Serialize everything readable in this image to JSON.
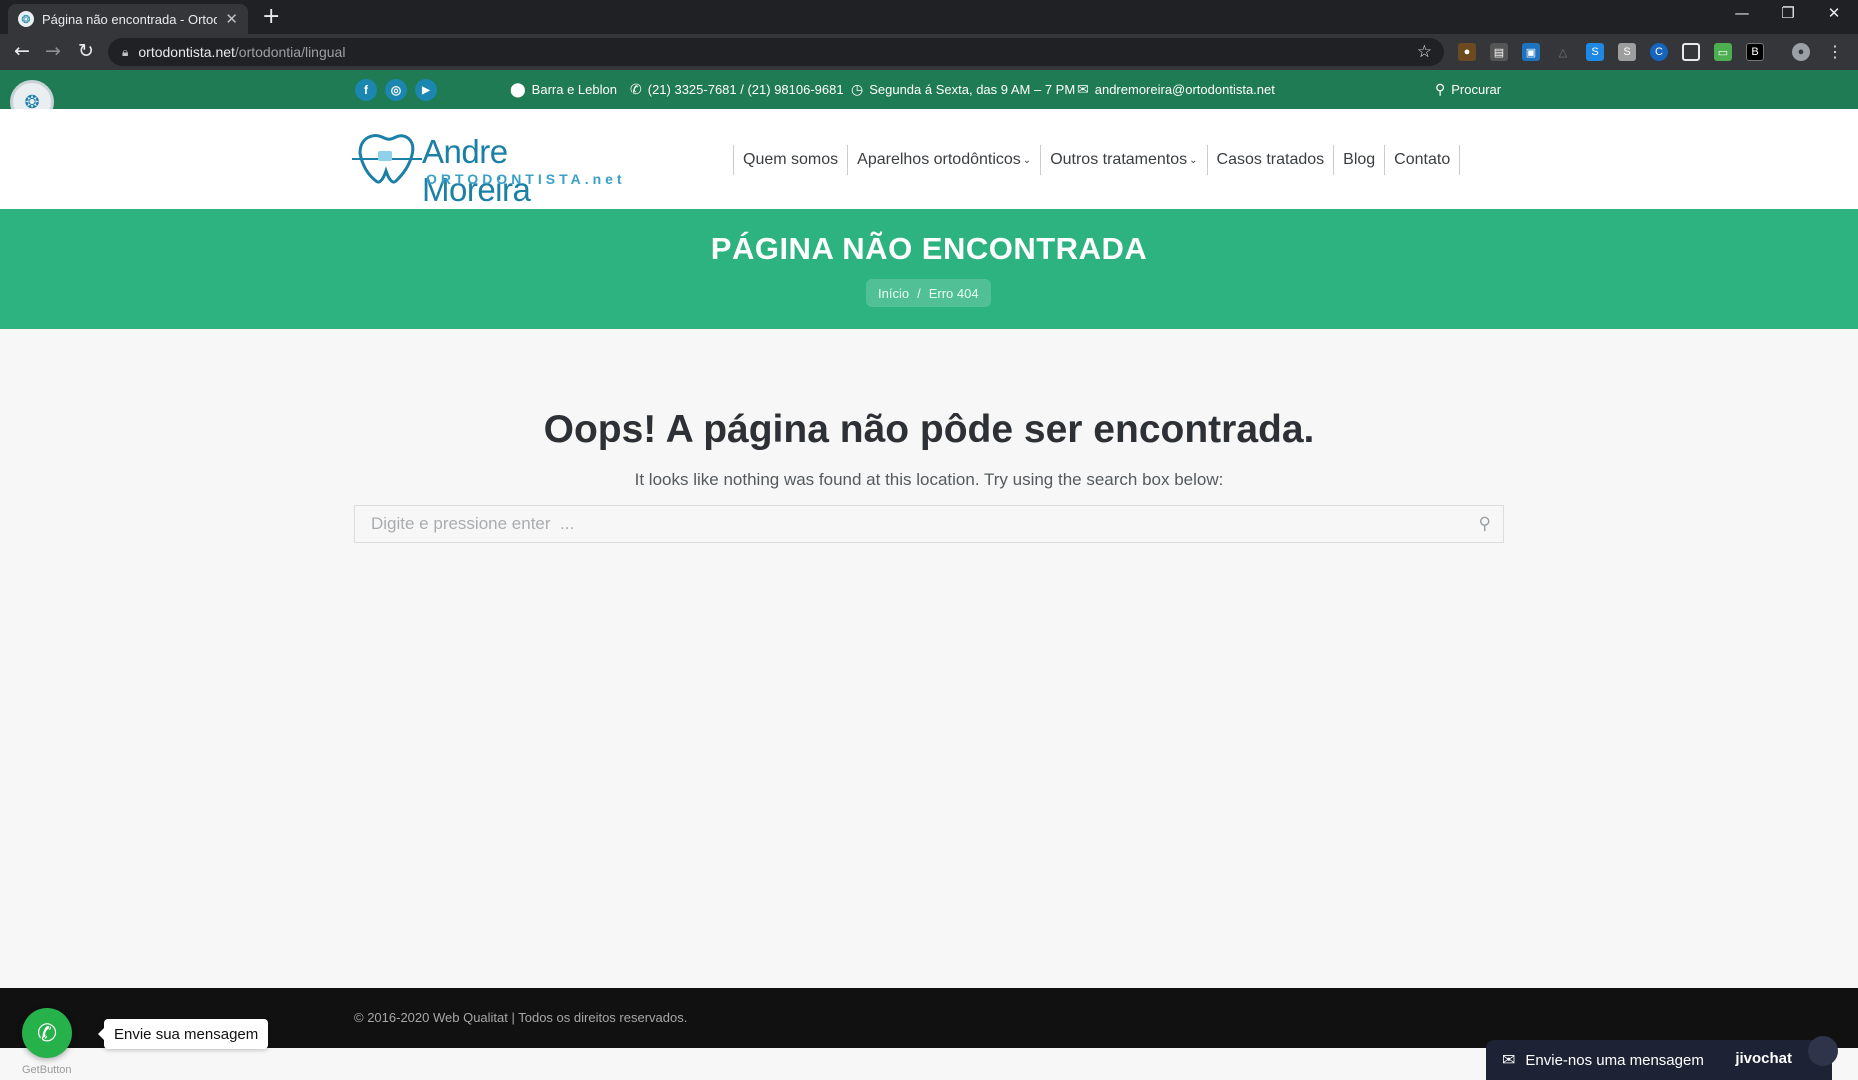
{
  "browser": {
    "tab_title": "Página não encontrada - Ortodontista",
    "tab_close": "✕",
    "new_tab": "+",
    "url_host": "ortodontista.net",
    "url_path": "/ortodontia/lingual",
    "window_controls": [
      "—",
      "❐",
      "✕"
    ],
    "icons": [
      "back-icon",
      "forward-icon",
      "reload-icon",
      "lock-icon",
      "star-icon",
      "profile-icon",
      "kebab-menu-icon"
    ]
  },
  "topbar": {
    "social": [
      "f",
      "◎",
      "▶"
    ],
    "location": "Barra e Leblon",
    "phone": "(21) 3325-7681 / (21) 98106-9681",
    "hours": "Segunda á Sexta, das 9 AM – 7 PM",
    "email": "andremoreira@ortodontista.net",
    "search_label": "Procurar"
  },
  "header": {
    "logo_brand": "Andre Moreira",
    "logo_sub": "ORTODONTISTA.net",
    "menu": [
      {
        "label": "Quem somos"
      },
      {
        "label": "Aparelhos ortodônticos",
        "dropdown": true
      },
      {
        "label": "Outros tratamentos",
        "dropdown": true
      },
      {
        "label": "Casos tratados"
      },
      {
        "label": "Blog"
      },
      {
        "label": "Contato"
      }
    ]
  },
  "hero": {
    "title": "PÁGINA NÃO ENCONTRADA",
    "breadcrumb_home": "Início",
    "breadcrumb_sep": "/",
    "breadcrumb_current": "Erro 404"
  },
  "main": {
    "heading": "Oops! A página não pôde ser encontrada.",
    "lead": "It looks like nothing was found at this location. Try using the search box below:",
    "search_placeholder": "Digite e pressione enter  ..."
  },
  "footer": {
    "copyright": "© 2016-2020 Web Qualitat | Todos os direitos reservados."
  },
  "widgets": {
    "whatsapp_tooltip": "Envie sua mensagem",
    "getbutton_label": "GetButton",
    "jivo_message": "Envie-nos uma mensagem",
    "jivo_brand": "jivochat"
  },
  "colors": {
    "topbar": "#1f7b54",
    "hero": "#2cb37f",
    "brand_blue": "#1b7fa6",
    "footer": "#111111",
    "whatsapp": "#26b14b",
    "jivo": "#1d2235"
  }
}
